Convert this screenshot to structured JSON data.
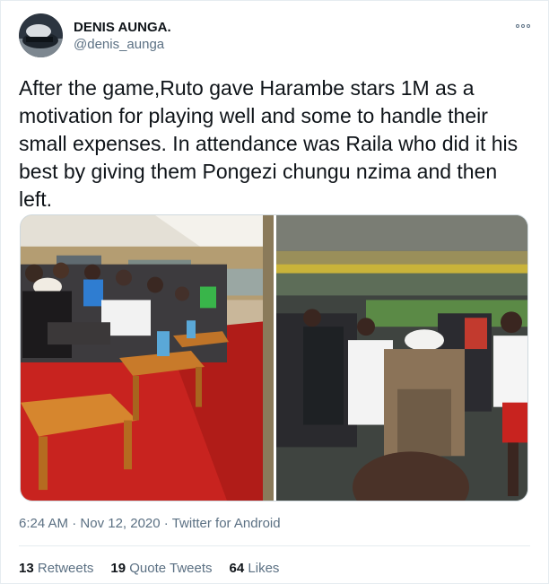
{
  "user": {
    "display_name": "DENIS AUNGA.",
    "handle": "@denis_aunga"
  },
  "tweet": {
    "text": "After the game,Ruto gave Harambe stars 1M as a motivation for playing well and some to handle their small expenses. In attendance was Raila who did it his best by giving them Pongezi chungu nzima and then left."
  },
  "meta": {
    "time": "6:24 AM",
    "separator": "·",
    "date": "Nov 12, 2020",
    "source": "Twitter for Android"
  },
  "stats": {
    "retweets_count": "13",
    "retweets_label": "Retweets",
    "quotes_count": "19",
    "quotes_label": "Quote Tweets",
    "likes_count": "64",
    "likes_label": "Likes"
  },
  "colors": {
    "text_primary": "#0f1419",
    "text_secondary": "#5b7083",
    "divider": "#e6ecf0"
  },
  "icons": {
    "more": "more-dots-icon"
  }
}
